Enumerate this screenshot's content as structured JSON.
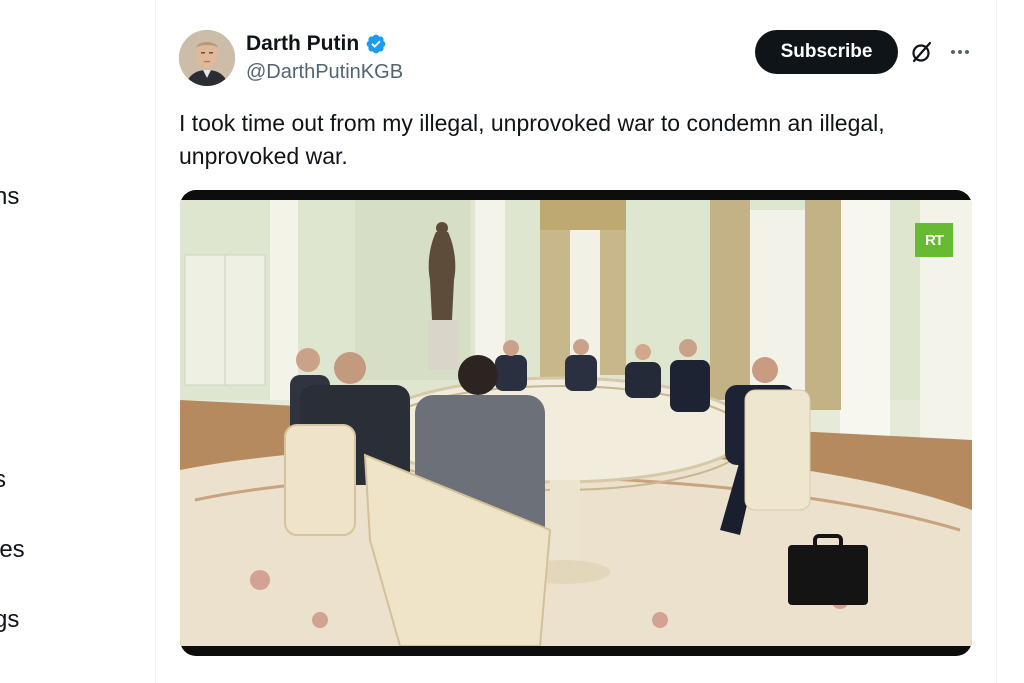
{
  "nav": {
    "items": [
      "ns",
      "s",
      "ies",
      "gs"
    ]
  },
  "tweet": {
    "author_name": "Darth Putin",
    "author_handle": "@DarthPutinKGB",
    "verified": true,
    "subscribe_label": "Subscribe",
    "text": "I took time out from my illegal, unprovoked war to condemn an illegal, unprovoked war.",
    "media": {
      "watermark": "RT"
    }
  },
  "colors": {
    "verified_badge": "#1d9bf0",
    "subscribe_bg": "#0f1419",
    "secondary_text": "#536471",
    "rt_green": "#66bb33"
  },
  "icons": [
    "verified-badge-icon",
    "grok-icon",
    "more-icon"
  ]
}
